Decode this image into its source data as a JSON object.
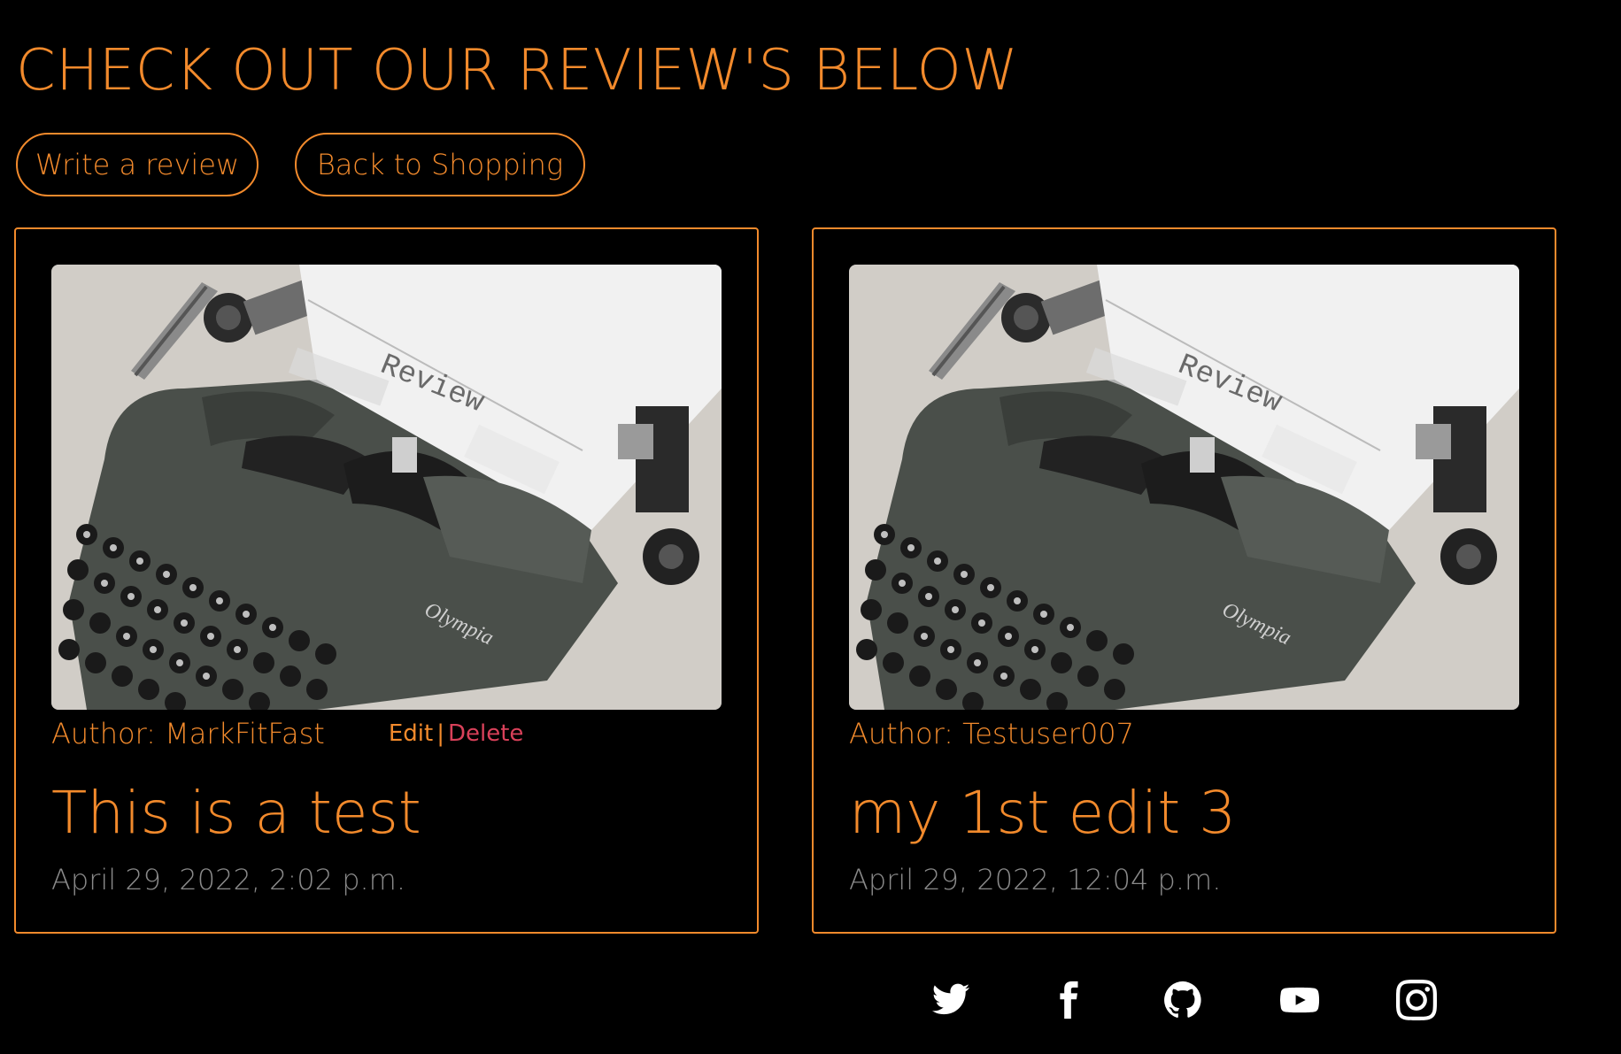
{
  "header": {
    "title": "CHECK OUT OUR REVIEW'S BELOW"
  },
  "buttons": {
    "write_review": "Write a review",
    "back_to_shopping": "Back to Shopping"
  },
  "reviews": [
    {
      "author_label": "Author: MarkFitFast",
      "title": "This is a test",
      "date": "April 29, 2022, 2:02 p.m.",
      "edit_label": "Edit",
      "separator": "|",
      "delete_label": "Delete"
    },
    {
      "author_label": "Author: Testuser007",
      "title": "my 1st edit 3",
      "date": "April 29, 2022, 12:04 p.m."
    }
  ],
  "typewriter_paper_text": "Review",
  "typewriter_brand_text": "Olympia",
  "footer": {
    "social_icons": [
      "twitter-icon",
      "facebook-icon",
      "github-icon",
      "youtube-icon",
      "instagram-icon"
    ]
  },
  "colors": {
    "background": "#000000",
    "accent": "#f28a2c",
    "delete": "#d9415a",
    "date": "#8a8a8a",
    "icons": "#ffffff"
  }
}
